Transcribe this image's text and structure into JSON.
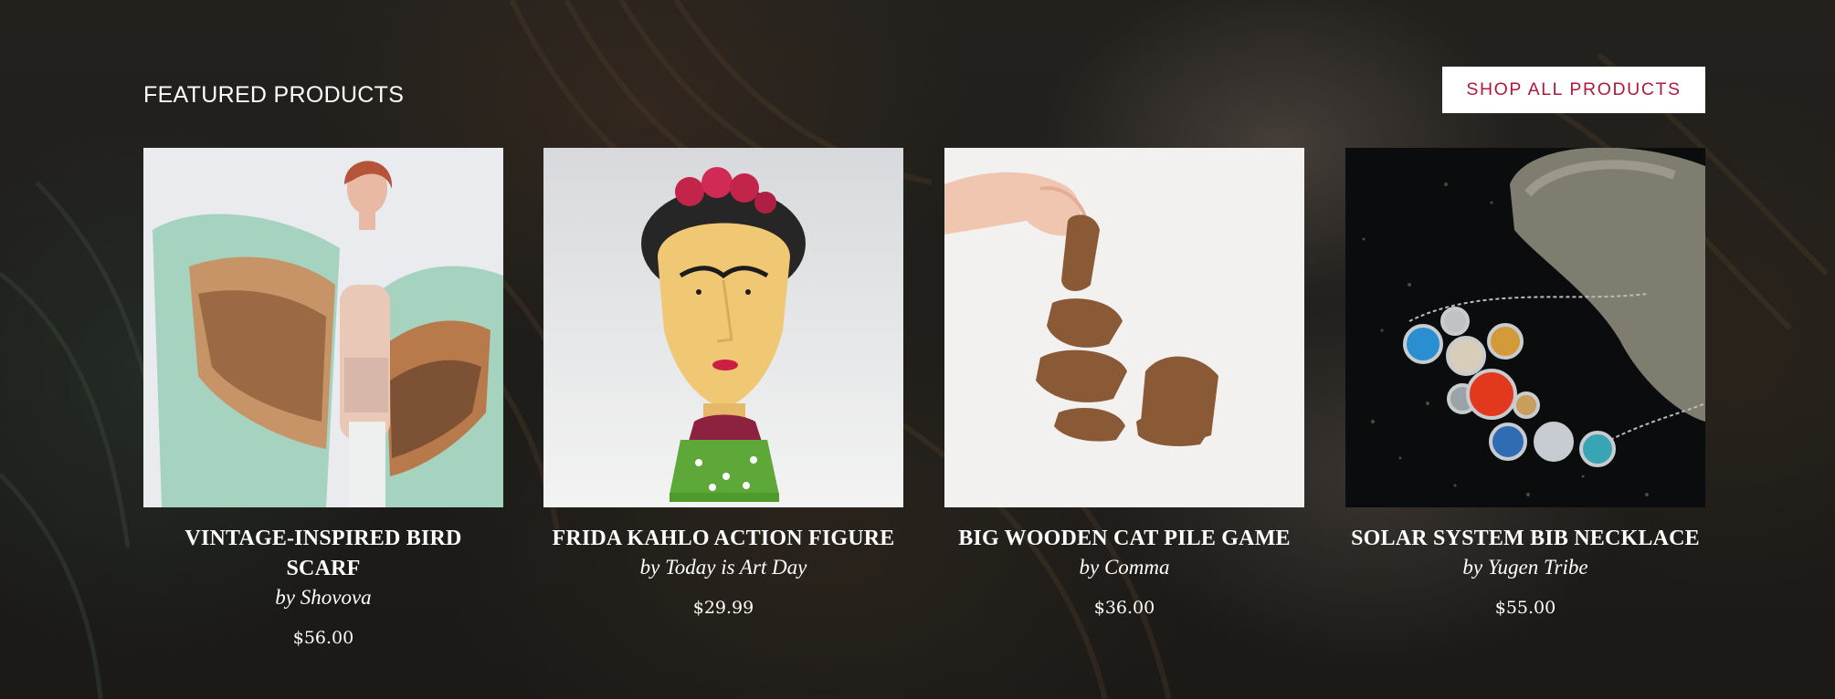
{
  "section": {
    "heading": "FEATURED PRODUCTS",
    "shop_all_label": "SHOP ALL PRODUCTS"
  },
  "products": [
    {
      "title": "VINTAGE-INSPIRED BIRD SCARF",
      "vendor": "by Shovova",
      "price": "$56.00"
    },
    {
      "title": "FRIDA KAHLO ACTION FIGURE",
      "vendor": "by Today is Art Day",
      "price": "$29.99"
    },
    {
      "title": "BIG WOODEN CAT PILE GAME",
      "vendor": "by Comma",
      "price": "$36.00"
    },
    {
      "title": "SOLAR SYSTEM BIB NECKLACE",
      "vendor": "by Yugen Tribe",
      "price": "$55.00"
    }
  ],
  "colors": {
    "button_text": "#b0193a",
    "button_bg": "#ffffff",
    "text": "#ffffff"
  }
}
